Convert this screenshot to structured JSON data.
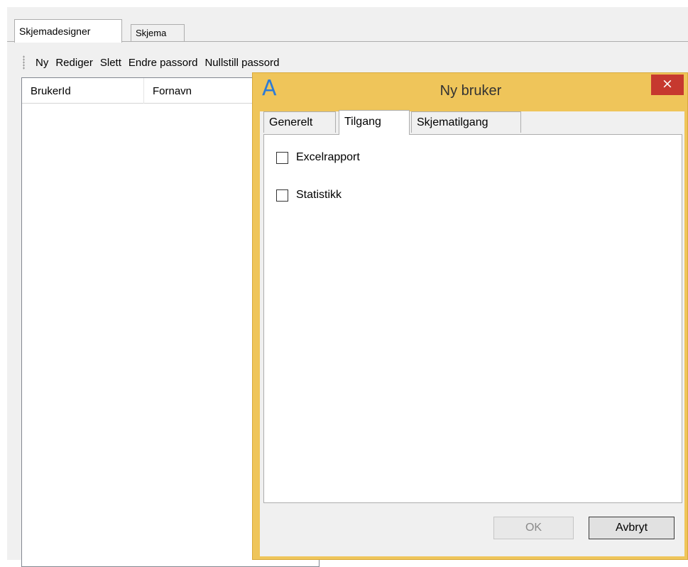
{
  "outer_tabs": [
    {
      "label": "Skjemadesigner",
      "active": true
    },
    {
      "label": "Skjema",
      "active": false
    }
  ],
  "toolbar": {
    "items": [
      "Ny",
      "Rediger",
      "Slett",
      "Endre passord",
      "Nullstill passord"
    ]
  },
  "grid": {
    "columns": [
      "BrukerId",
      "Fornavn"
    ]
  },
  "dialog": {
    "title": "Ny bruker",
    "app_icon": "app-logo-icon",
    "close_glyph": "×",
    "tabs": [
      {
        "label": "Generelt",
        "active": false
      },
      {
        "label": "Tilgang",
        "active": true
      },
      {
        "label": "Skjematilgang",
        "active": false
      }
    ],
    "checkboxes": [
      {
        "label": "Excelrapport",
        "checked": false
      },
      {
        "label": "Statistikk",
        "checked": false
      }
    ],
    "ok_label": "OK",
    "cancel_label": "Avbryt"
  },
  "colors": {
    "dialog_frame": "#efc55a",
    "close_button": "#c6382f",
    "app_icon": "#2d7bd6"
  }
}
